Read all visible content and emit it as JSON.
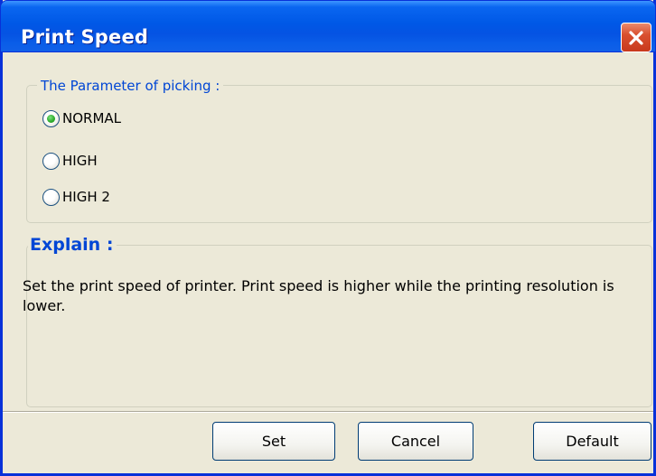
{
  "window": {
    "title": "Print Speed",
    "close_icon": "close-icon"
  },
  "picking": {
    "legend": "The Parameter of picking :",
    "options": [
      {
        "label": "NORMAL",
        "checked": true
      },
      {
        "label": "HIGH",
        "checked": false
      },
      {
        "label": "HIGH 2",
        "checked": false
      }
    ]
  },
  "explain": {
    "legend": "Explain :",
    "text": "Set the print speed of printer. Print speed is higher while the printing resolution is lower."
  },
  "buttons": {
    "set": "Set",
    "cancel": "Cancel",
    "default": "Default"
  },
  "colors": {
    "titlebar": "#0058e6",
    "face": "#ece9d8",
    "legend_text": "#0046d5",
    "close_button": "#d9502f",
    "radio_dot": "#2fae2f"
  }
}
